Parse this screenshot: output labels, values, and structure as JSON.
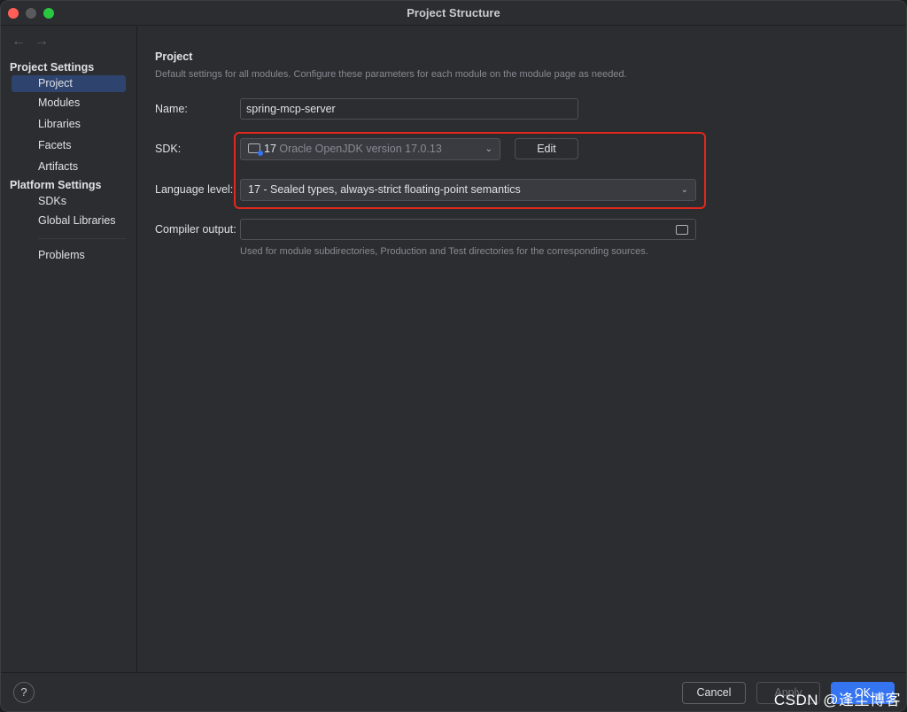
{
  "window": {
    "title": "Project Structure"
  },
  "sidebar": {
    "nav": {
      "back": "←",
      "forward": "→"
    },
    "sections": [
      {
        "header": "Project Settings",
        "items": [
          {
            "label": "Project",
            "selected": true
          },
          {
            "label": "Modules"
          },
          {
            "label": "Libraries"
          },
          {
            "label": "Facets"
          },
          {
            "label": "Artifacts"
          }
        ]
      },
      {
        "header": "Platform Settings",
        "items": [
          {
            "label": "SDKs"
          },
          {
            "label": "Global Libraries"
          }
        ]
      }
    ],
    "problems": "Problems"
  },
  "main": {
    "title": "Project",
    "description": "Default settings for all modules. Configure these parameters for each module on the module page as needed.",
    "name_label": "Name:",
    "name_value": "spring-mcp-server",
    "sdk_label": "SDK:",
    "sdk_version": "17",
    "sdk_name": "Oracle OpenJDK version 17.0.13",
    "sdk_edit": "Edit",
    "language_label": "Language level:",
    "language_value": "17 - Sealed types, always-strict floating-point semantics",
    "compiler_label": "Compiler output:",
    "compiler_value": "",
    "compiler_hint": "Used for module subdirectories, Production and Test directories for the corresponding sources."
  },
  "footer": {
    "help": "?",
    "cancel": "Cancel",
    "apply": "Apply",
    "ok": "OK",
    "watermark": "CSDN @逢尘博客"
  },
  "colors": {
    "accent": "#3574f0",
    "highlight": "#e0281d",
    "selection": "#2e436e"
  }
}
